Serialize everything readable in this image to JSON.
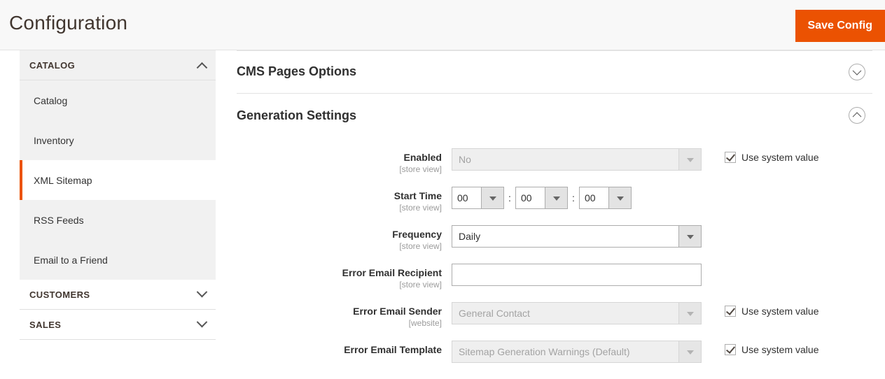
{
  "header": {
    "title": "Configuration",
    "save_label": "Save Config"
  },
  "sidebar": {
    "sections": [
      {
        "label": "CATALOG",
        "expanded": true,
        "toggle_icon": "chevron-up-icon"
      },
      {
        "label": "CUSTOMERS",
        "expanded": false,
        "toggle_icon": "chevron-down-icon"
      },
      {
        "label": "SALES",
        "expanded": false,
        "toggle_icon": "chevron-down-icon"
      }
    ],
    "catalog_items": [
      {
        "label": "Catalog",
        "active": false
      },
      {
        "label": "Inventory",
        "active": false
      },
      {
        "label": "XML Sitemap",
        "active": true
      },
      {
        "label": "RSS Feeds",
        "active": false
      },
      {
        "label": "Email to a Friend",
        "active": false
      }
    ]
  },
  "main": {
    "sections": [
      {
        "title": "CMS Pages Options",
        "expanded": false,
        "toggle_icon": "circle-chevron-down-icon"
      },
      {
        "title": "Generation Settings",
        "expanded": true,
        "toggle_icon": "circle-chevron-up-icon"
      }
    ],
    "generation_settings": {
      "fields": [
        {
          "label": "Enabled",
          "scope": "[store view]",
          "type": "select",
          "value": "No",
          "disabled": true,
          "use_system_value": true,
          "use_system_label": "Use system value"
        },
        {
          "label": "Start Time",
          "scope": "[store view]",
          "type": "time",
          "hours": "00",
          "minutes": "00",
          "seconds": "00",
          "separator": ":",
          "disabled": false,
          "use_system_value": false
        },
        {
          "label": "Frequency",
          "scope": "[store view]",
          "type": "select",
          "value": "Daily",
          "disabled": false,
          "use_system_value": false
        },
        {
          "label": "Error Email Recipient",
          "scope": "[store view]",
          "type": "text",
          "value": "",
          "placeholder": "",
          "disabled": false,
          "use_system_value": false
        },
        {
          "label": "Error Email Sender",
          "scope": "[website]",
          "type": "select",
          "value": "General Contact",
          "disabled": true,
          "use_system_value": true,
          "use_system_label": "Use system value"
        },
        {
          "label": "Error Email Template",
          "scope": "",
          "type": "select",
          "value": "Sitemap Generation Warnings (Default)",
          "disabled": true,
          "use_system_value": true,
          "use_system_label": "Use system value"
        }
      ]
    }
  },
  "colors": {
    "accent": "#eb5202",
    "header_bg": "#f8f8f8",
    "nav_bg": "#f1f1f1",
    "border": "#e3e3e3",
    "text": "#303030",
    "muted": "#9b9b9b"
  }
}
